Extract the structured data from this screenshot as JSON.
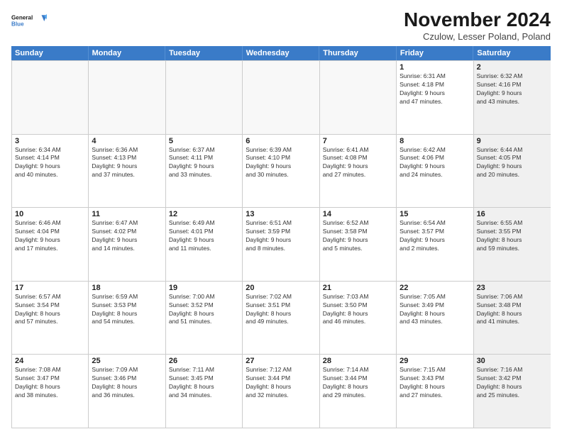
{
  "logo": {
    "line1": "General",
    "line2": "Blue"
  },
  "title": "November 2024",
  "subtitle": "Czulow, Lesser Poland, Poland",
  "dayNames": [
    "Sunday",
    "Monday",
    "Tuesday",
    "Wednesday",
    "Thursday",
    "Friday",
    "Saturday"
  ],
  "weeks": [
    [
      {
        "day": "",
        "info": "",
        "empty": true
      },
      {
        "day": "",
        "info": "",
        "empty": true
      },
      {
        "day": "",
        "info": "",
        "empty": true
      },
      {
        "day": "",
        "info": "",
        "empty": true
      },
      {
        "day": "",
        "info": "",
        "empty": true
      },
      {
        "day": "1",
        "info": "Sunrise: 6:31 AM\nSunset: 4:18 PM\nDaylight: 9 hours\nand 47 minutes.",
        "empty": false,
        "shaded": false
      },
      {
        "day": "2",
        "info": "Sunrise: 6:32 AM\nSunset: 4:16 PM\nDaylight: 9 hours\nand 43 minutes.",
        "empty": false,
        "shaded": true
      }
    ],
    [
      {
        "day": "3",
        "info": "Sunrise: 6:34 AM\nSunset: 4:14 PM\nDaylight: 9 hours\nand 40 minutes.",
        "empty": false,
        "shaded": false
      },
      {
        "day": "4",
        "info": "Sunrise: 6:36 AM\nSunset: 4:13 PM\nDaylight: 9 hours\nand 37 minutes.",
        "empty": false,
        "shaded": false
      },
      {
        "day": "5",
        "info": "Sunrise: 6:37 AM\nSunset: 4:11 PM\nDaylight: 9 hours\nand 33 minutes.",
        "empty": false,
        "shaded": false
      },
      {
        "day": "6",
        "info": "Sunrise: 6:39 AM\nSunset: 4:10 PM\nDaylight: 9 hours\nand 30 minutes.",
        "empty": false,
        "shaded": false
      },
      {
        "day": "7",
        "info": "Sunrise: 6:41 AM\nSunset: 4:08 PM\nDaylight: 9 hours\nand 27 minutes.",
        "empty": false,
        "shaded": false
      },
      {
        "day": "8",
        "info": "Sunrise: 6:42 AM\nSunset: 4:06 PM\nDaylight: 9 hours\nand 24 minutes.",
        "empty": false,
        "shaded": false
      },
      {
        "day": "9",
        "info": "Sunrise: 6:44 AM\nSunset: 4:05 PM\nDaylight: 9 hours\nand 20 minutes.",
        "empty": false,
        "shaded": true
      }
    ],
    [
      {
        "day": "10",
        "info": "Sunrise: 6:46 AM\nSunset: 4:04 PM\nDaylight: 9 hours\nand 17 minutes.",
        "empty": false,
        "shaded": false
      },
      {
        "day": "11",
        "info": "Sunrise: 6:47 AM\nSunset: 4:02 PM\nDaylight: 9 hours\nand 14 minutes.",
        "empty": false,
        "shaded": false
      },
      {
        "day": "12",
        "info": "Sunrise: 6:49 AM\nSunset: 4:01 PM\nDaylight: 9 hours\nand 11 minutes.",
        "empty": false,
        "shaded": false
      },
      {
        "day": "13",
        "info": "Sunrise: 6:51 AM\nSunset: 3:59 PM\nDaylight: 9 hours\nand 8 minutes.",
        "empty": false,
        "shaded": false
      },
      {
        "day": "14",
        "info": "Sunrise: 6:52 AM\nSunset: 3:58 PM\nDaylight: 9 hours\nand 5 minutes.",
        "empty": false,
        "shaded": false
      },
      {
        "day": "15",
        "info": "Sunrise: 6:54 AM\nSunset: 3:57 PM\nDaylight: 9 hours\nand 2 minutes.",
        "empty": false,
        "shaded": false
      },
      {
        "day": "16",
        "info": "Sunrise: 6:55 AM\nSunset: 3:55 PM\nDaylight: 8 hours\nand 59 minutes.",
        "empty": false,
        "shaded": true
      }
    ],
    [
      {
        "day": "17",
        "info": "Sunrise: 6:57 AM\nSunset: 3:54 PM\nDaylight: 8 hours\nand 57 minutes.",
        "empty": false,
        "shaded": false
      },
      {
        "day": "18",
        "info": "Sunrise: 6:59 AM\nSunset: 3:53 PM\nDaylight: 8 hours\nand 54 minutes.",
        "empty": false,
        "shaded": false
      },
      {
        "day": "19",
        "info": "Sunrise: 7:00 AM\nSunset: 3:52 PM\nDaylight: 8 hours\nand 51 minutes.",
        "empty": false,
        "shaded": false
      },
      {
        "day": "20",
        "info": "Sunrise: 7:02 AM\nSunset: 3:51 PM\nDaylight: 8 hours\nand 49 minutes.",
        "empty": false,
        "shaded": false
      },
      {
        "day": "21",
        "info": "Sunrise: 7:03 AM\nSunset: 3:50 PM\nDaylight: 8 hours\nand 46 minutes.",
        "empty": false,
        "shaded": false
      },
      {
        "day": "22",
        "info": "Sunrise: 7:05 AM\nSunset: 3:49 PM\nDaylight: 8 hours\nand 43 minutes.",
        "empty": false,
        "shaded": false
      },
      {
        "day": "23",
        "info": "Sunrise: 7:06 AM\nSunset: 3:48 PM\nDaylight: 8 hours\nand 41 minutes.",
        "empty": false,
        "shaded": true
      }
    ],
    [
      {
        "day": "24",
        "info": "Sunrise: 7:08 AM\nSunset: 3:47 PM\nDaylight: 8 hours\nand 38 minutes.",
        "empty": false,
        "shaded": false
      },
      {
        "day": "25",
        "info": "Sunrise: 7:09 AM\nSunset: 3:46 PM\nDaylight: 8 hours\nand 36 minutes.",
        "empty": false,
        "shaded": false
      },
      {
        "day": "26",
        "info": "Sunrise: 7:11 AM\nSunset: 3:45 PM\nDaylight: 8 hours\nand 34 minutes.",
        "empty": false,
        "shaded": false
      },
      {
        "day": "27",
        "info": "Sunrise: 7:12 AM\nSunset: 3:44 PM\nDaylight: 8 hours\nand 32 minutes.",
        "empty": false,
        "shaded": false
      },
      {
        "day": "28",
        "info": "Sunrise: 7:14 AM\nSunset: 3:44 PM\nDaylight: 8 hours\nand 29 minutes.",
        "empty": false,
        "shaded": false
      },
      {
        "day": "29",
        "info": "Sunrise: 7:15 AM\nSunset: 3:43 PM\nDaylight: 8 hours\nand 27 minutes.",
        "empty": false,
        "shaded": false
      },
      {
        "day": "30",
        "info": "Sunrise: 7:16 AM\nSunset: 3:42 PM\nDaylight: 8 hours\nand 25 minutes.",
        "empty": false,
        "shaded": true
      }
    ]
  ]
}
